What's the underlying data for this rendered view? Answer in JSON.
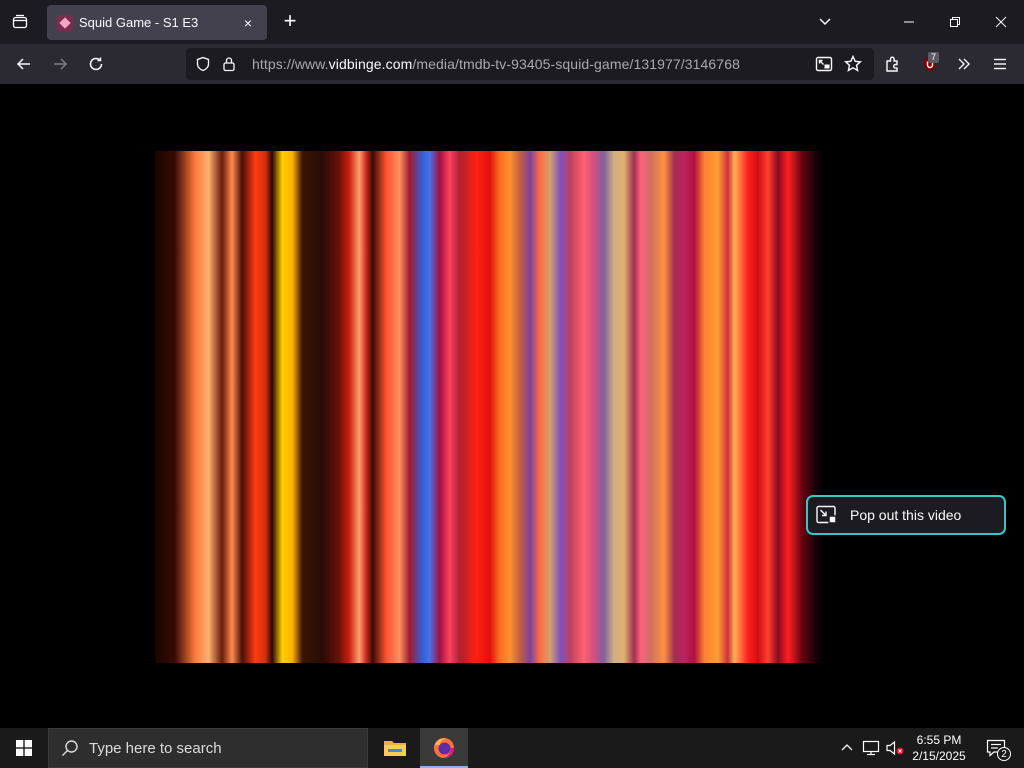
{
  "browser": {
    "tab": {
      "title": "Squid Game - S1 E3",
      "close_label": "×"
    },
    "new_tab_label": "+",
    "url": {
      "prefix": "https://www.",
      "domain": "vidbinge.com",
      "path": "/media/tmdb-tv-93405-squid-game/131977/3146768"
    },
    "extension_badge": "7",
    "icons": [
      "tab-list-icon",
      "chevron-down-icon",
      "minimize-icon",
      "maximize-icon",
      "close-icon",
      "back-icon",
      "forward-icon",
      "reload-icon",
      "shield-icon",
      "lock-icon",
      "picture-in-picture-icon",
      "bookmark-star-icon",
      "extensions-icon",
      "ublock-icon",
      "overflow-chevrons-icon",
      "hamburger-menu-icon"
    ]
  },
  "video": {
    "popout_label": "Pop out this video",
    "accent_color": "#38c5c8"
  },
  "taskbar": {
    "search_placeholder": "Type here to search",
    "time": "6:55 PM",
    "date": "2/15/2025",
    "notification_count": "2",
    "icons": [
      "windows-start-icon",
      "search-icon",
      "file-explorer-icon",
      "firefox-icon",
      "chevron-up-icon",
      "network-icon",
      "volume-muted-icon",
      "notifications-icon"
    ]
  }
}
